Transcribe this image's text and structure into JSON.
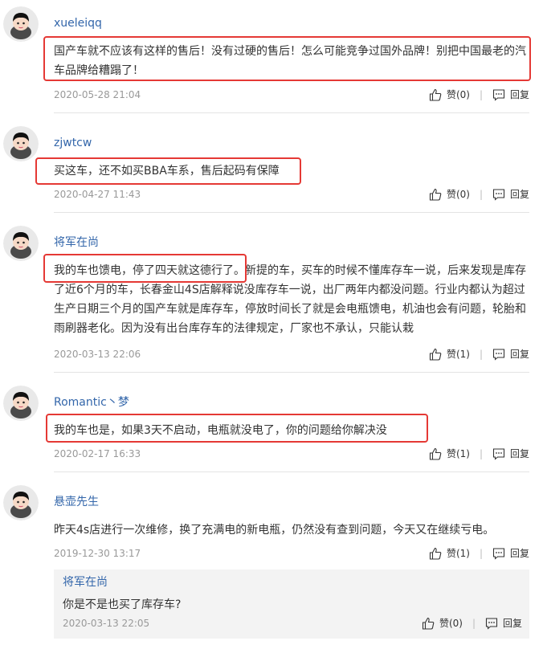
{
  "comments": [
    {
      "user": "xueleiqq",
      "text": "国产车就不应该有这样的售后！没有过硬的售后！怎么可能竞争过国外品牌！别把中国最老的汽车品牌给糟蹋了！",
      "text_lines": [
        "国产车就不应该有这样的售后！没有过硬的售后！怎么可能竞争过国外品牌！别把中国最老的汽",
        "车品牌给糟蹋了！"
      ],
      "date": "2020-05-28 21:04",
      "like": "赞(0)",
      "reply": "回复"
    },
    {
      "user": "zjwtcw",
      "text": "买这车，还不如买BBA车系，售后起码有保障",
      "text_lines": [
        "买这车，还不如买BBA车系，售后起码有保障"
      ],
      "date": "2020-04-27 11:43",
      "like": "赞(0)",
      "reply": "回复"
    },
    {
      "user": "将军在尚",
      "text": "我的车也馈电，停了四天就这德行了。新提的车，买车的时候不懂库存车一说，后来发现是库存了近6个月的车，长春金山4S店解释说没库存车一说，出厂两年内都没问题。行业内都认为超过生产日期三个月的国产车就是库存车，停放时间长了就是会电瓶馈电，机油也会有问题，轮胎和雨刷器老化。因为没有出台库存车的法律规定，厂家也不承认，只能认栽",
      "text_lines": [
        "我的车也馈电，停了四天就这德行了。新提的车，买车的时候不懂库存车一说，后来发现是库存",
        "了近6个月的车，长春金山4S店解释说没库存车一说，出厂两年内都没问题。行业内都认为超过",
        "生产日期三个月的国产车就是库存车，停放时间长了就是会电瓶馈电，机油也会有问题，轮胎和",
        "雨刷器老化。因为没有出台库存车的法律规定，厂家也不承认，只能认栽"
      ],
      "date": "2020-03-13 22:06",
      "like": "赞(1)",
      "reply": "回复"
    },
    {
      "user": "Romantic丶梦",
      "text": "我的车也是，如果3天不启动，电瓶就没电了，你的问题给你解决没",
      "text_lines": [
        "我的车也是，如果3天不启动，电瓶就没电了，你的问题给你解决没"
      ],
      "date": "2020-02-17 16:33",
      "like": "赞(1)",
      "reply": "回复"
    },
    {
      "user": "悬壶先生",
      "text": "昨天4s店进行一次维修，换了充满电的新电瓶，仍然没有查到问题，今天又在继续亏电。",
      "text_lines": [
        "昨天4s店进行一次维修，换了充满电的新电瓶，仍然没有查到问题，今天又在继续亏电。"
      ],
      "date": "2019-12-30 13:17",
      "like": "赞(1)",
      "reply": "回复",
      "sub_reply": {
        "user": "将军在尚",
        "text": "你是不是也买了库存车?",
        "date": "2020-03-13 22:05",
        "like": "赞(0)",
        "reply": "回复"
      }
    }
  ],
  "icons": {
    "like": "thumbs-up-icon",
    "reply": "comment-bubble-icon",
    "avatar": "cartoon-avatar"
  },
  "colors": {
    "username": "#3366aa",
    "highlight": "#e53935",
    "reply_bg": "#f3f3f3",
    "date": "#999999"
  }
}
